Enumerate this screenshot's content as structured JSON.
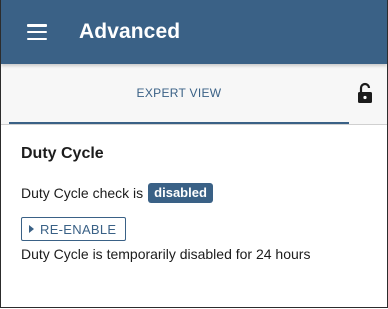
{
  "app_bar": {
    "menu_icon": "menu-icon",
    "title": "Advanced",
    "background": "#3a6186"
  },
  "tabs": {
    "active_label": "EXPERT VIEW",
    "lock_icon": "lock-open-icon"
  },
  "duty_cycle": {
    "heading": "Duty Cycle",
    "status_prefix": "Duty Cycle check is",
    "status_badge": "disabled",
    "reenable_button": "RE-ENABLE",
    "reenable_icon": "play-arrow-icon",
    "note": "Duty Cycle is temporarily disabled for 24 hours"
  }
}
